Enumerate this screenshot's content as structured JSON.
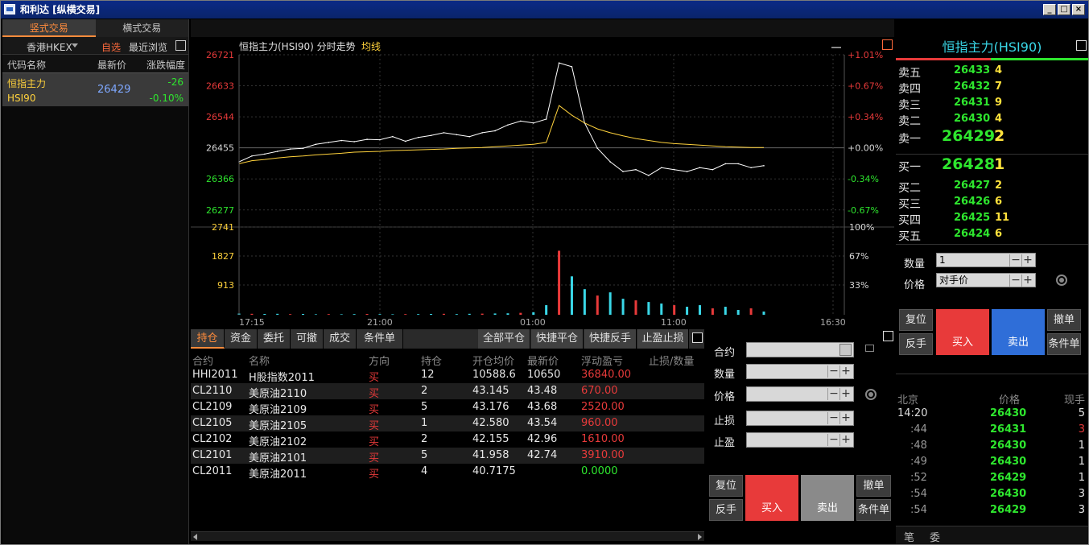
{
  "window": {
    "title": "和利达 [纵横交易]",
    "min": "_",
    "max": "□",
    "close": "×"
  },
  "left": {
    "tabs": [
      "竖式交易",
      "横式交易"
    ],
    "market": "香港HKEX",
    "favorites": "自选",
    "recent": "最近浏览",
    "headers": [
      "代码名称",
      "最新价",
      "涨跌幅度"
    ],
    "row": {
      "name": "恒指主力",
      "code": "HSI90",
      "price": "26429",
      "change": "-26",
      "pct": "-0.10%"
    }
  },
  "chart": {
    "title": "恒指主力(HSI90) 分时走势",
    "avg_label": "均线",
    "price_ticks": [
      "26721",
      "26633",
      "26544",
      "26455",
      "26366",
      "26277"
    ],
    "pct_ticks": [
      "+1.01%",
      "+0.67%",
      "+0.34%",
      "+0.00%",
      "-0.34%",
      "-0.67%"
    ],
    "vol_ticks": [
      "2741",
      "1827",
      "913"
    ],
    "vol_pct_ticks": [
      "100%",
      "67%",
      "33%"
    ],
    "time_ticks": [
      "17:15",
      "21:00",
      "01:00",
      "11:00",
      "16:30"
    ]
  },
  "chart_data": {
    "type": "line",
    "title": "恒指主力(HSI90) 分时走势",
    "series": [
      {
        "name": "",
        "values": [
          26445,
          26460,
          26465,
          26472,
          26478,
          26480,
          26490,
          26495,
          26500,
          26497,
          26503,
          26502,
          26510,
          26498,
          26508,
          26513,
          26520,
          26515,
          26510,
          26520,
          26525,
          26540,
          26550,
          26545,
          26555,
          26700,
          26690,
          26545,
          26480,
          26445,
          26420,
          26425,
          26410,
          26430,
          26425,
          26420,
          26430,
          26425,
          26440,
          26440,
          26430,
          26435
        ]
      },
      {
        "name": "均线",
        "values": [
          26440,
          26448,
          26451,
          26455,
          26458,
          26460,
          26463,
          26465,
          26467,
          26470,
          26471,
          26472,
          26474,
          26475,
          26476,
          26477,
          26478,
          26480,
          26481,
          26482,
          26484,
          26486,
          26488,
          26490,
          26495,
          26590,
          26565,
          26545,
          26530,
          26520,
          26512,
          26505,
          26500,
          26495,
          26492,
          26490,
          26488,
          26486,
          26484,
          26483,
          26482,
          26482
        ]
      }
    ],
    "ylim": [
      26277,
      26721
    ],
    "volume_ylim": [
      0,
      2741
    ],
    "volume": [
      40,
      30,
      25,
      30,
      20,
      25,
      15,
      20,
      15,
      20,
      25,
      20,
      15,
      20,
      20,
      25,
      30,
      20,
      30,
      35,
      40,
      45,
      60,
      80,
      300,
      2000,
      1200,
      800,
      600,
      700,
      500,
      450,
      400,
      350,
      300,
      250,
      300,
      200,
      250,
      150,
      200,
      100
    ],
    "x_ticks": [
      "17:15",
      "21:00",
      "01:00",
      "11:00",
      "16:30"
    ],
    "grid": true
  },
  "positions": {
    "tabs": [
      "持仓",
      "资金",
      "委托",
      "可撤",
      "成交",
      "条件单"
    ],
    "actions": [
      "全部平仓",
      "快捷平仓",
      "快捷反手",
      "止盈止损"
    ],
    "headers": [
      "合约",
      "名称",
      "方向",
      "持仓",
      "开仓均价",
      "最新价",
      "浮动盈亏",
      "止损/数量"
    ],
    "rows": [
      {
        "code": "HHI2011",
        "name": "H股指数2011",
        "dir": "买",
        "qty": "12",
        "open": "10588.6",
        "last": "10650",
        "pnl": "36840.00"
      },
      {
        "code": "CL2110",
        "name": "美原油2110",
        "dir": "买",
        "qty": "2",
        "open": "43.145",
        "last": "43.48",
        "pnl": "670.00"
      },
      {
        "code": "CL2109",
        "name": "美原油2109",
        "dir": "买",
        "qty": "5",
        "open": "43.176",
        "last": "43.68",
        "pnl": "2520.00"
      },
      {
        "code": "CL2105",
        "name": "美原油2105",
        "dir": "买",
        "qty": "1",
        "open": "42.580",
        "last": "43.54",
        "pnl": "960.00"
      },
      {
        "code": "CL2102",
        "name": "美原油2102",
        "dir": "买",
        "qty": "2",
        "open": "42.155",
        "last": "42.96",
        "pnl": "1610.00"
      },
      {
        "code": "CL2101",
        "name": "美原油2101",
        "dir": "买",
        "qty": "5",
        "open": "41.958",
        "last": "42.74",
        "pnl": "3910.00"
      },
      {
        "code": "CL2011",
        "name": "美原油2011",
        "dir": "买",
        "qty": "4",
        "open": "40.7175",
        "last": "",
        "pnl": "0.0000"
      }
    ]
  },
  "order": {
    "labels": [
      "合约",
      "数量",
      "价格",
      "止损",
      "止盈"
    ],
    "reset": "复位",
    "reverse": "反手",
    "buy": "买入",
    "sell": "卖出",
    "cancel": "撤单",
    "cond": "条件单"
  },
  "quote": {
    "title": "恒指主力(HSI90)",
    "asks": [
      {
        "label": "卖五",
        "price": "26433",
        "vol": "4"
      },
      {
        "label": "卖四",
        "price": "26432",
        "vol": "7"
      },
      {
        "label": "卖三",
        "price": "26431",
        "vol": "9"
      },
      {
        "label": "卖二",
        "price": "26430",
        "vol": "4"
      },
      {
        "label": "卖一",
        "price": "26429",
        "vol": "2"
      }
    ],
    "bids": [
      {
        "label": "买一",
        "price": "26428",
        "vol": "1"
      },
      {
        "label": "买二",
        "price": "26427",
        "vol": "2"
      },
      {
        "label": "买三",
        "price": "26426",
        "vol": "6"
      },
      {
        "label": "买四",
        "price": "26425",
        "vol": "11"
      },
      {
        "label": "买五",
        "price": "26424",
        "vol": "6"
      }
    ],
    "qty_label": "数量",
    "qty_value": "1",
    "price_label": "价格",
    "price_value": "对手价",
    "reset": "复位",
    "reverse": "反手",
    "buy": "买入",
    "sell": "卖出",
    "cancel": "撤单",
    "cond": "条件单",
    "tick_headers": [
      "北京",
      "价格",
      "现手"
    ],
    "ticks": [
      {
        "t": "14:20",
        "p": "26430",
        "v": "5"
      },
      {
        "t": ":44",
        "p": "26431",
        "v": "3"
      },
      {
        "t": ":48",
        "p": "26430",
        "v": "1"
      },
      {
        "t": ":49",
        "p": "26430",
        "v": "1"
      },
      {
        "t": ":52",
        "p": "26429",
        "v": "1"
      },
      {
        "t": ":54",
        "p": "26430",
        "v": "3"
      },
      {
        "t": ":54",
        "p": "26429",
        "v": "3"
      }
    ],
    "bottom_tabs": [
      "笔",
      "委"
    ]
  },
  "colors": {
    "up": "#e83a3a",
    "down": "#2ee62e",
    "accent": "#ff8c3c",
    "avg": "#ffd23c",
    "title": "#3ad8e8"
  }
}
